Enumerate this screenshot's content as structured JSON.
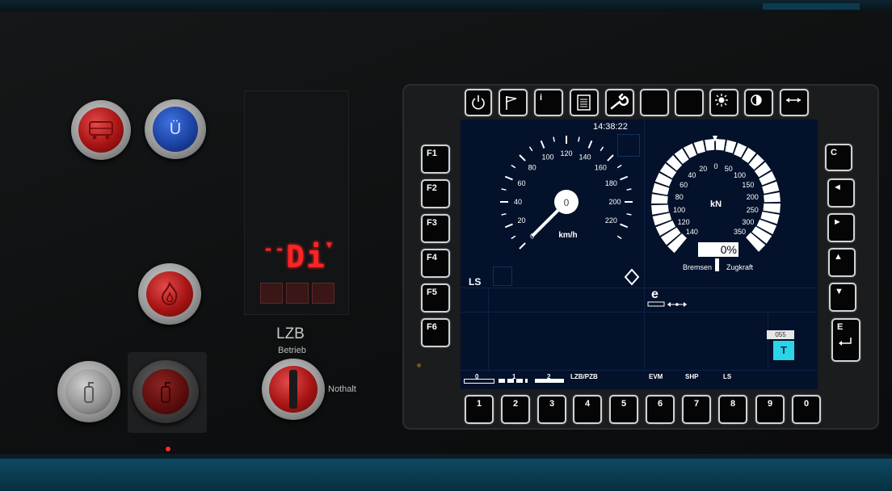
{
  "left_panel": {
    "ue_label": "Ü",
    "lzb_display": "Di",
    "lzb_title": "LZB",
    "lzb_subtitle": "Betrieb",
    "nothalt_label": "Nothalt"
  },
  "dmi": {
    "top_keys": [
      {
        "id": "power",
        "icon": "power-icon"
      },
      {
        "id": "flag",
        "icon": "flag-icon"
      },
      {
        "id": "info",
        "label": "i"
      },
      {
        "id": "document",
        "icon": "document-icon"
      },
      {
        "id": "wrench",
        "icon": "wrench-icon"
      },
      {
        "id": "blank1",
        "label": ""
      },
      {
        "id": "blank2",
        "label": ""
      },
      {
        "id": "brightness",
        "icon": "sun-icon"
      },
      {
        "id": "contrast",
        "icon": "contrast-icon"
      },
      {
        "id": "swap",
        "icon": "swap-arrows-icon"
      }
    ],
    "f_keys": [
      "F1",
      "F2",
      "F3",
      "F4",
      "F5",
      "F6"
    ],
    "right_keys": [
      "C",
      "◄",
      "►",
      "▲",
      "▼",
      "E"
    ],
    "bottom_keys": [
      "1",
      "2",
      "3",
      "4",
      "5",
      "6",
      "7",
      "8",
      "9",
      "0"
    ],
    "clock": "14:38:22",
    "speedometer": {
      "ticks": [
        "0",
        "20",
        "40",
        "60",
        "80",
        "100",
        "120",
        "140",
        "160",
        "180",
        "200",
        "220"
      ],
      "unit": "km/h",
      "current_value": "0",
      "needle_value": 0
    },
    "force_gauge": {
      "left_ticks": [
        "20",
        "40",
        "60",
        "80",
        "100",
        "120",
        "140"
      ],
      "top_tick": "0",
      "right_ticks": [
        "50",
        "100",
        "150",
        "200",
        "250",
        "300",
        "350"
      ],
      "unit": "kN",
      "percent": "0",
      "percent_sign": "%",
      "left_label": "Bremsen",
      "right_label": "Zugkraft"
    },
    "ls_label": "LS",
    "e_label": "e",
    "indicator_t": "T",
    "indicator_055": "055",
    "status_bar": {
      "level_0": "0",
      "level_1": "1",
      "level_2": "2",
      "lzb_pzb": "LZB/PZB",
      "evm": "EVM",
      "shp": "SHP",
      "ls": "LS"
    }
  }
}
